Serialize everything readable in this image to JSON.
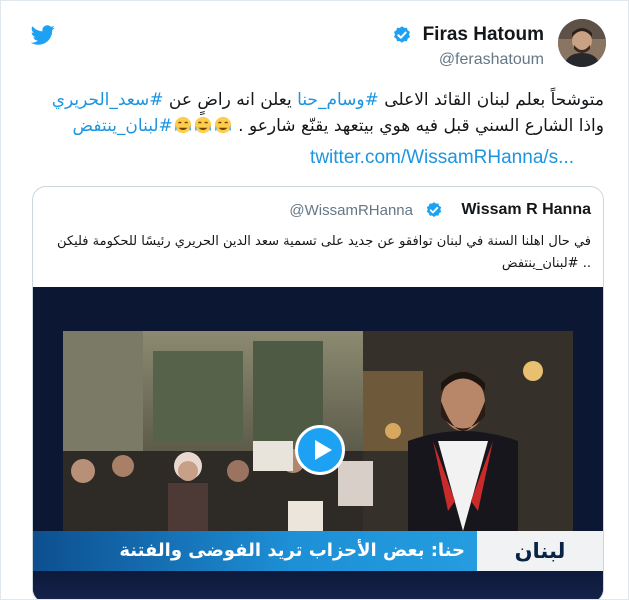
{
  "tweet": {
    "author_name": "Firas Hatoum",
    "author_handle": "@ferashatoum",
    "text_plain_1": "متوشحاً بعلم لبنان القائد الاعلى ",
    "hashtag_1": "#وسام_حنا",
    "text_plain_2": " يعلن انه راضٍ عن ",
    "hashtag_2": "#سعد_الحريري",
    "text_plain_3": " واذا الشارع السني قبل فيه هوي بيتعهد يقنّع شارعو . ",
    "hashtag_3": "#لبنان_ينتفض",
    "emoji": [
      "face-with-tears-of-joy",
      "face-with-tears-of-joy",
      "face-with-tears-of-joy"
    ],
    "url": "twitter.com/WissamRHanna/s..."
  },
  "quoted": {
    "author_name": "Wissam R Hanna",
    "author_handle": "@WissamRHanna",
    "text": "في حال اهلنا السنة في لبنان توافقو عن جديد على تسمية سعد الدين الحريري رئيسًا للحكومة فليكن .. ",
    "hashtag": "#لبنان_ينتفض",
    "video": {
      "banner_tag": "لبنان",
      "banner_text": "حنا: بعض الأحزاب تريد الفوضى والفتنة"
    }
  },
  "colors": {
    "brand_blue": "#1da1f2",
    "link_blue": "#1b95e0",
    "secondary_text": "#657786"
  },
  "icons": [
    "twitter-bird-icon",
    "verified-badge-icon",
    "play-icon"
  ]
}
